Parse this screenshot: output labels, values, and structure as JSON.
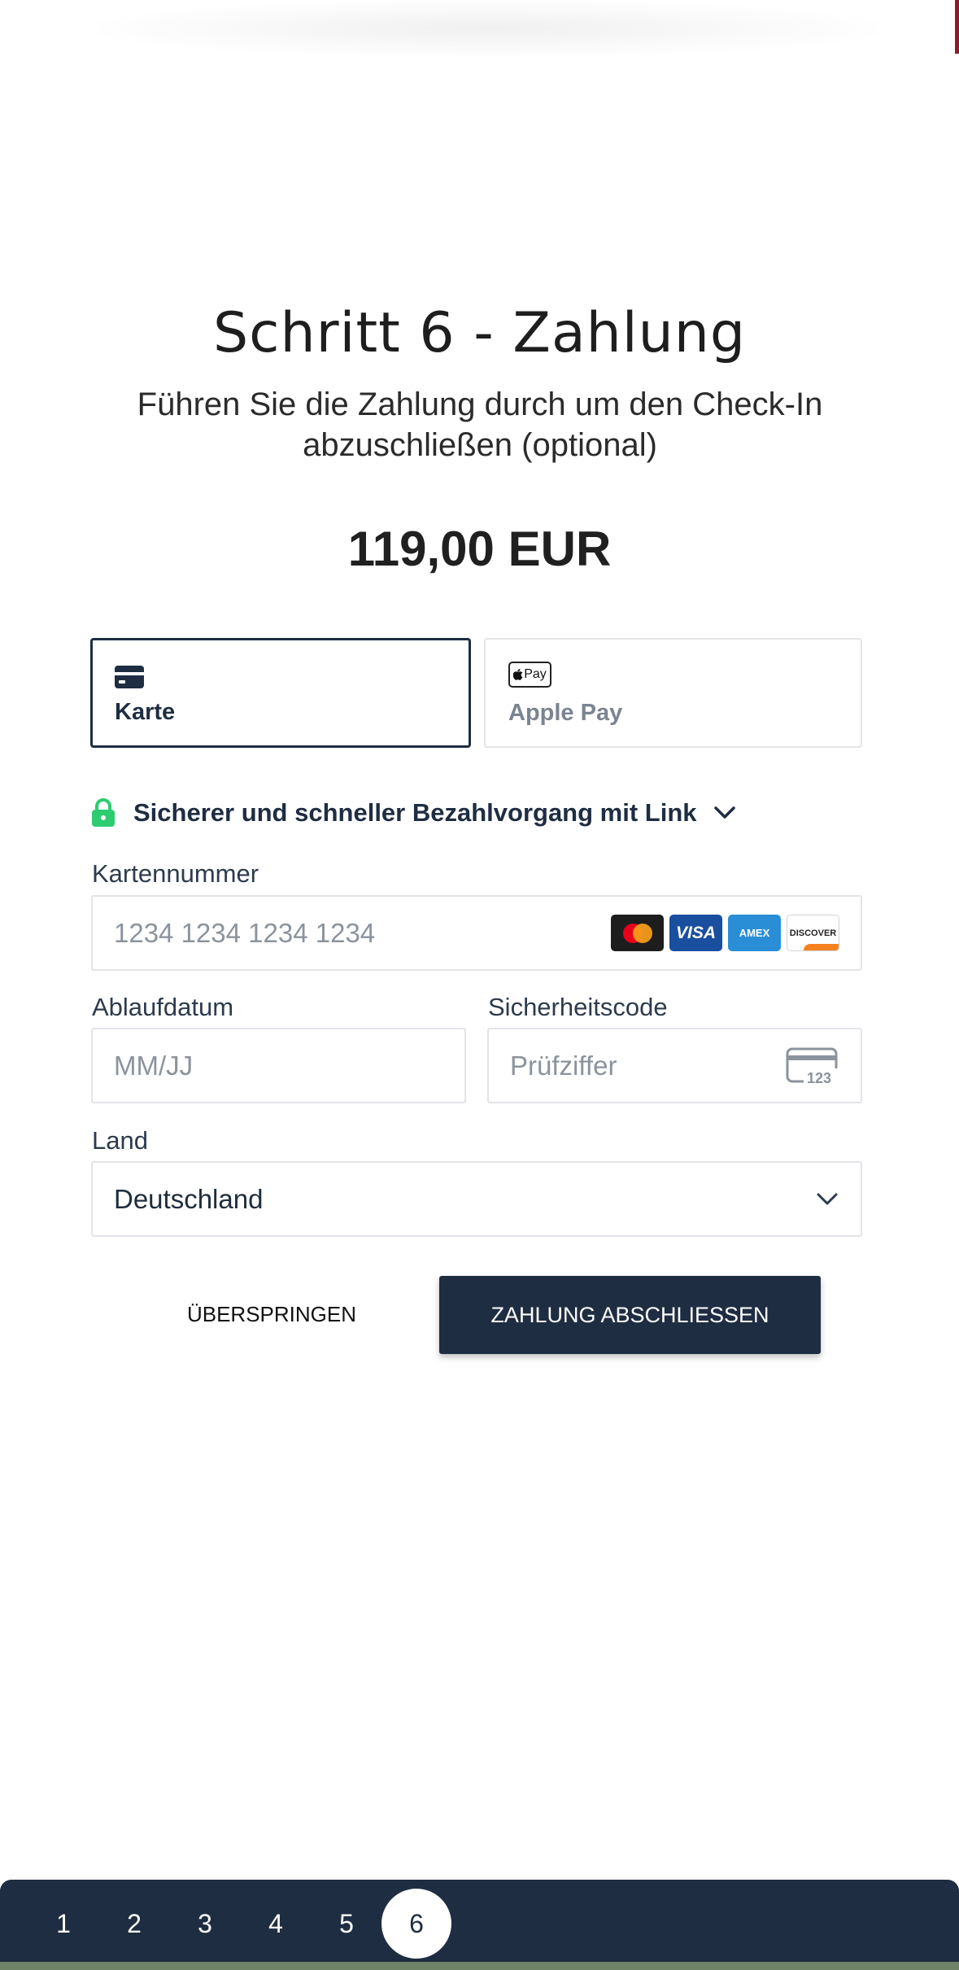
{
  "header": {
    "title": "Schritt 6 - Zahlung",
    "subtitle": "Führen Sie die Zahlung durch um den Check-In abzuschließen (optional)"
  },
  "payment": {
    "amount": "119,00 EUR",
    "methods": [
      {
        "label": "Karte",
        "icon": "credit-card-icon",
        "active": true
      },
      {
        "label": "Apple Pay",
        "icon": "apple-pay-icon",
        "badge_text": "Pay",
        "active": false
      }
    ],
    "link_text": "Sicherer und schneller Bezahlvorgang mit Link",
    "card_number": {
      "label": "Kartennummer",
      "placeholder": "1234 1234 1234 1234",
      "brands": [
        "mastercard",
        "visa",
        "amex",
        "discover"
      ],
      "brand_texts": {
        "visa": "VISA",
        "amex": "AMEX",
        "discover": "DISCOVER"
      }
    },
    "expiry": {
      "label": "Ablaufdatum",
      "placeholder": "MM/JJ"
    },
    "cvc": {
      "label": "Sicherheitscode",
      "placeholder": "Prüfziffer",
      "icon_text": "123"
    },
    "country": {
      "label": "Land",
      "value": "Deutschland"
    }
  },
  "actions": {
    "skip_label": "ÜBERSPRINGEN",
    "pay_label": "ZAHLUNG ABSCHLIESSEN"
  },
  "stepper": {
    "steps": [
      "1",
      "2",
      "3",
      "4",
      "5",
      "6"
    ],
    "active_step": "6"
  },
  "colors": {
    "primary": "#1f2d42",
    "lock_green": "#2ecc71",
    "top_accent": "#8c1c2c"
  }
}
